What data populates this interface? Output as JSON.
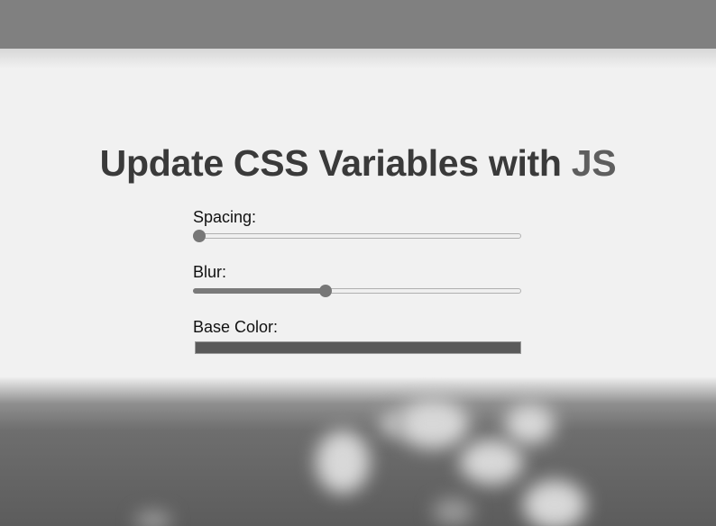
{
  "header": {
    "title_main": "Update CSS Variables with ",
    "title_highlight": "JS"
  },
  "controls": {
    "spacing": {
      "label": "Spacing:",
      "value": 0
    },
    "blur": {
      "label": "Blur:",
      "value": 0.4
    },
    "base_color": {
      "label": "Base Color:",
      "value": "#5a5a5a"
    }
  },
  "photo": {
    "icon": "blurred-photo-image"
  }
}
